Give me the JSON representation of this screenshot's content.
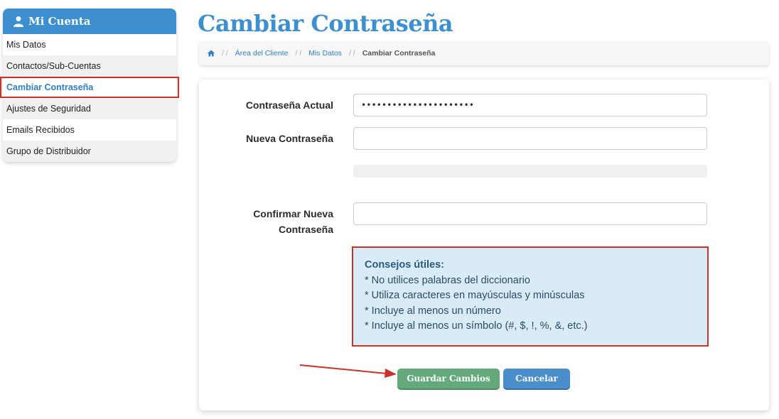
{
  "sidebar": {
    "title": "Mi Cuenta",
    "items": [
      {
        "label": "Mis Datos"
      },
      {
        "label": "Contactos/Sub-Cuentas"
      },
      {
        "label": "Cambiar Contraseña"
      },
      {
        "label": "Ajustes de Seguridad"
      },
      {
        "label": "Emails Recibidos"
      },
      {
        "label": "Grupo de Distribuidor"
      }
    ]
  },
  "page": {
    "title": "Cambiar Contraseña"
  },
  "breadcrumb": {
    "items": [
      "Área del Cliente",
      "Mis Datos"
    ],
    "current": "Cambiar Contraseña",
    "separator": "/ /"
  },
  "form": {
    "current_password": {
      "label": "Contraseña Actual",
      "value": "••••••••••••••••••••••"
    },
    "new_password": {
      "label": "Nueva Contraseña",
      "value": ""
    },
    "confirm_password": {
      "label_line1": "Confirmar Nueva",
      "label_line2": "Contraseña",
      "value": ""
    }
  },
  "tips": {
    "title": "Consejos útiles:",
    "items": [
      "* No utilices palabras del diccionario",
      "* Utiliza caracteres en mayúsculas y minúsculas",
      "* Incluye al menos un número",
      "* Incluye al menos un símbolo (#, $, !, %, &, etc.)"
    ]
  },
  "buttons": {
    "save": "Guardar Cambios",
    "cancel": "Cancelar"
  },
  "colors": {
    "accent": "#3d8fcf",
    "highlight": "#c9332c",
    "save": "#63a97b",
    "tips_bg": "#d9ebf7"
  }
}
